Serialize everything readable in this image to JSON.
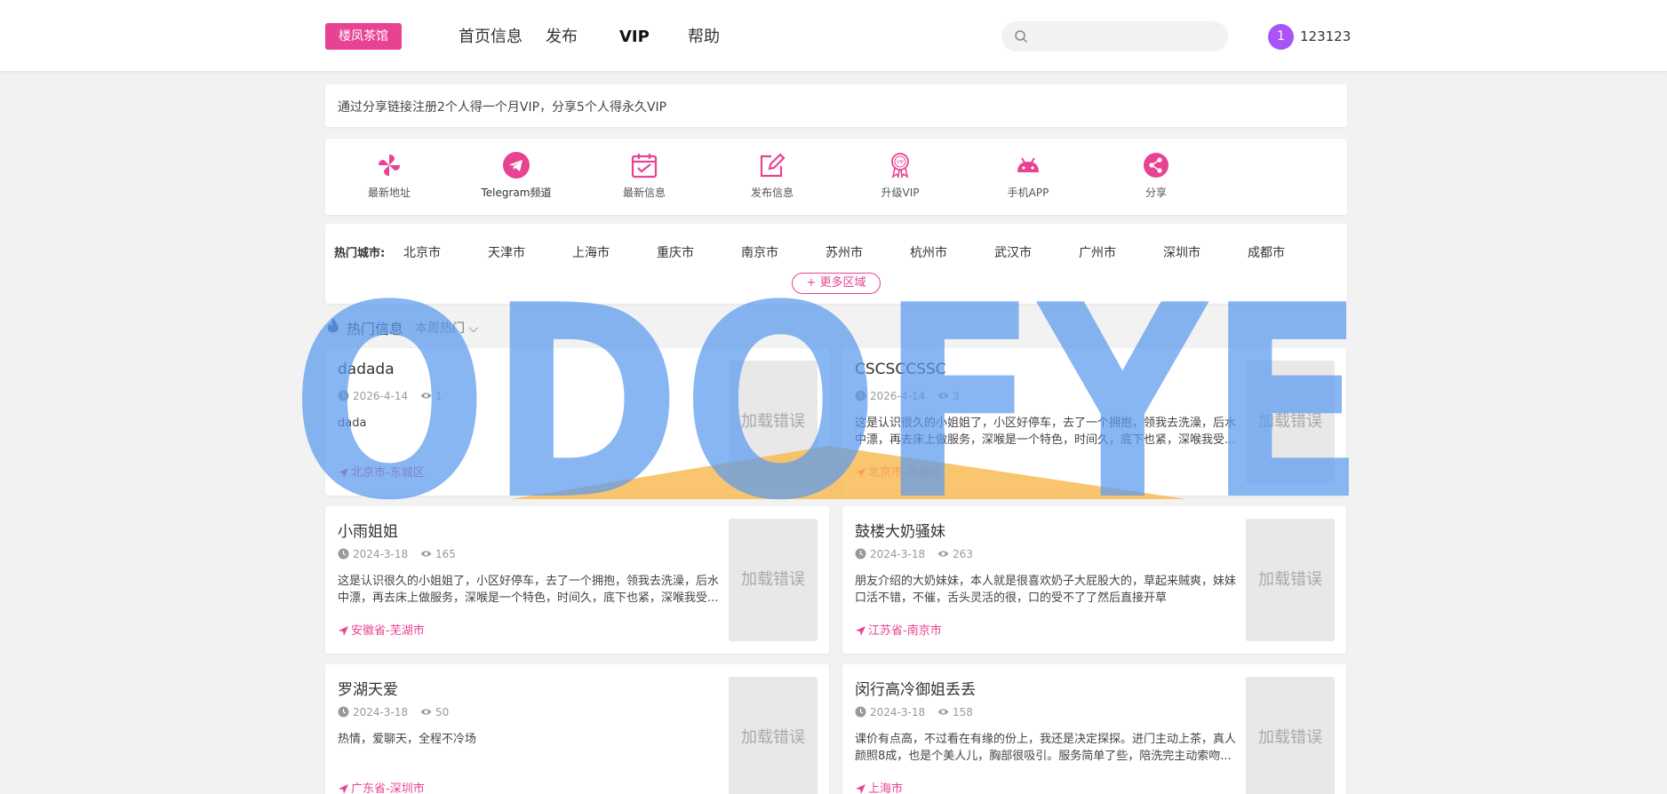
{
  "header": {
    "logo": "楼凤茶馆",
    "nav": [
      "首页信息",
      "发布",
      "VIP",
      "帮助"
    ],
    "search": {
      "placeholder": ""
    },
    "user": {
      "avatar_letter": "1",
      "name": "123123"
    }
  },
  "notice": "通过分享链接注册2个人得一个月VIP，分享5个人得永久VIP",
  "quick_links": [
    {
      "label": "最新地址",
      "icon": "pinwheel-icon"
    },
    {
      "label": "Telegram频道",
      "icon": "telegram-icon"
    },
    {
      "label": "最新信息",
      "icon": "calendar-icon"
    },
    {
      "label": "发布信息",
      "icon": "edit-icon"
    },
    {
      "label": "升级VIP",
      "icon": "vip-badge-icon"
    },
    {
      "label": "手机APP",
      "icon": "android-icon"
    },
    {
      "label": "分享",
      "icon": "share-icon"
    }
  ],
  "cities": {
    "title": "热门城市:",
    "items": [
      "北京市",
      "天津市",
      "上海市",
      "重庆市",
      "南京市",
      "苏州市",
      "杭州市",
      "武汉市",
      "广州市",
      "深圳市",
      "成都市"
    ],
    "more": "更多区域"
  },
  "section": {
    "title": "热门信息",
    "filter": "本周热门"
  },
  "listings": [
    {
      "title": "dadada",
      "date": "2026-4-14",
      "views": "1",
      "desc": "dada",
      "location": "北京市-东城区",
      "image_text": "加载错误"
    },
    {
      "title": "CSCSCCSSC",
      "date": "2026-4-14",
      "views": "3",
      "desc": "这是认识很久的小姐姐了，小区好停车，去了一个拥抱，领我去洗澡，后水中漂，再去床上做服务，深喉是一个特色，时间久，底下也紧，深喉我受...",
      "location": "北京市-东城区",
      "image_text": "加载错误"
    },
    {
      "title": "小雨姐姐",
      "date": "2024-3-18",
      "views": "165",
      "desc": "这是认识很久的小姐姐了，小区好停车，去了一个拥抱，领我去洗澡，后水中漂，再去床上做服务，深喉是一个特色，时间久，底下也紧，深喉我受...",
      "location": "安徽省-芜湖市",
      "image_text": "加载错误"
    },
    {
      "title": "鼓楼大奶骚妹",
      "date": "2024-3-18",
      "views": "263",
      "desc": "朋友介绍的大奶妹妹，本人就是很喜欢奶子大屁股大的，草起来贼爽，妹妹口活不错，不催，舌头灵活的很，口的受不了了然后直接开草",
      "location": "江苏省-南京市",
      "image_text": "加载错误"
    },
    {
      "title": "罗湖天爱",
      "date": "2024-3-18",
      "views": "50",
      "desc": "热情，爱聊天，全程不冷场",
      "location": "广东省-深圳市",
      "image_text": "加载错误"
    },
    {
      "title": "闵行高冷御姐丢丢",
      "date": "2024-3-18",
      "views": "158",
      "desc": "课价有点高，不过看在有缘的份上，我还是决定探探。进门主动上茶，真人颜照8成，也是个美人儿，胸部很吸引。服务简单了些，陪洗完主动索吻...",
      "location": "上海市",
      "image_text": "加载错误"
    }
  ],
  "watermark": {
    "text": "ODOFYE"
  },
  "colors": {
    "accent": "#e84393",
    "avatar": "#a855f7",
    "watermark_blue": "#5b9aef",
    "watermark_orange": "#f7b84b"
  }
}
